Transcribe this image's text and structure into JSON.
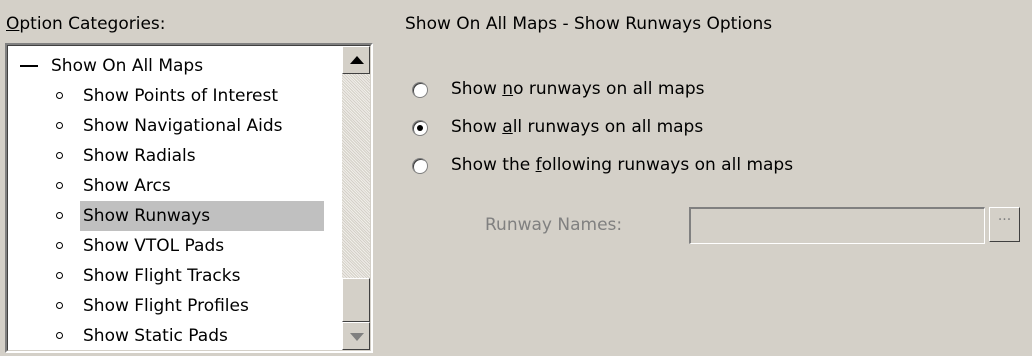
{
  "left_panel": {
    "label_prefix": "O",
    "label_rest": "ption Categories:",
    "tree": {
      "root": "Show On All Maps",
      "children": [
        "Show Points of Interest",
        "Show Navigational Aids",
        "Show Radials",
        "Show Arcs",
        "Show Runways",
        "Show VTOL Pads",
        "Show Flight Tracks",
        "Show Flight Profiles",
        "Show Static Pads"
      ],
      "selected": "Show Runways"
    }
  },
  "right_panel": {
    "title": "Show On All Maps - Show Runways Options",
    "options": [
      {
        "pre": "Show ",
        "key": "n",
        "post": "o runways on all maps",
        "checked": false
      },
      {
        "pre": "Show ",
        "key": "a",
        "post": "ll runways on all maps",
        "checked": true
      },
      {
        "pre": "Show the ",
        "key": "f",
        "post": "ollowing runways on all maps",
        "checked": false
      }
    ],
    "runway_names_label": "Runway Names:",
    "runway_names_value": "",
    "browse_label": "···"
  }
}
